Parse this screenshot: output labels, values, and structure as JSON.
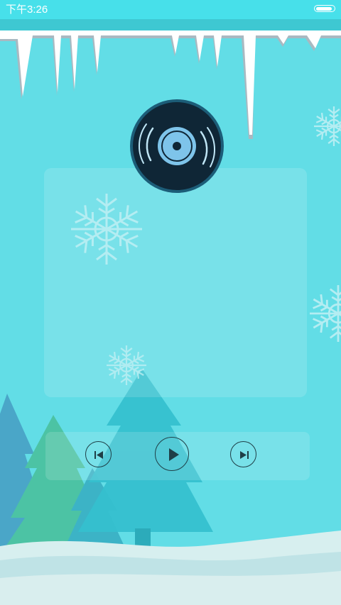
{
  "status_bar": {
    "time": "下午3:26"
  },
  "icons": {
    "disc": "vinyl-disc-icon",
    "snowflake": "snowflake-icon",
    "previous": "skip-previous-icon",
    "play": "play-icon",
    "next": "skip-next-icon",
    "battery": "battery-icon"
  },
  "colors": {
    "background": "#62dde6",
    "status_bar": "#47e0ea",
    "title_band": "#3ec8d2",
    "disc": "#0f2636",
    "disc_label": "#7ec4ea",
    "control_outline": "#1f3f47"
  }
}
